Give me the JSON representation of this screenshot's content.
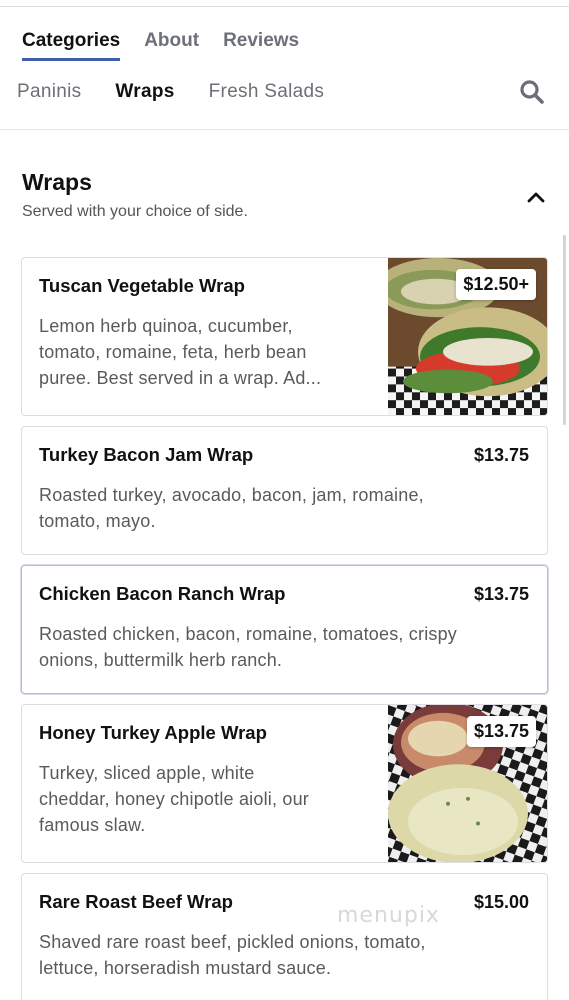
{
  "nav": {
    "top_tabs": [
      {
        "label": "Categories",
        "active": true
      },
      {
        "label": "About",
        "active": false
      },
      {
        "label": "Reviews",
        "active": false
      }
    ],
    "sub_tabs": [
      {
        "label": "Paninis",
        "active": false
      },
      {
        "label": "Wraps",
        "active": true
      },
      {
        "label": "Fresh Salads",
        "active": false
      }
    ],
    "search_icon": "search-icon"
  },
  "section": {
    "title": "Wraps",
    "subtitle": "Served with your choice of side.",
    "collapse_icon": "chevron-up-icon"
  },
  "items": [
    {
      "name": "Tuscan Vegetable Wrap",
      "price": "$12.50+",
      "desc_lines": [
        "Lemon herb quinoa, cucumber,",
        "tomato, romaine, feta, herb bean",
        "puree. Best served in a wrap. Ad..."
      ],
      "has_image": true
    },
    {
      "name": "Turkey Bacon Jam Wrap",
      "price": "$13.75",
      "desc_lines": [
        "Roasted turkey, avocado, bacon, jam, romaine,",
        "tomato, mayo."
      ],
      "has_image": false
    },
    {
      "name": "Chicken Bacon Ranch Wrap",
      "price": "$13.75",
      "desc_lines": [
        "Roasted chicken, bacon, romaine, tomatoes, crispy",
        "onions, buttermilk herb ranch."
      ],
      "has_image": false
    },
    {
      "name": "Honey Turkey Apple Wrap",
      "price": "$13.75",
      "desc_lines": [
        "Turkey, sliced apple, white",
        "cheddar, honey chipotle aioli, our",
        "famous slaw."
      ],
      "has_image": true
    },
    {
      "name": "Rare Roast Beef Wrap",
      "price": "$15.00",
      "desc_lines": [
        "Shaved rare roast beef, pickled onions, tomato,",
        "lettuce, horseradish mustard sauce."
      ],
      "has_image": false
    }
  ],
  "watermark": "menupix",
  "colors": {
    "active_underline": "#3d5fa8",
    "text_primary": "#111111",
    "text_muted": "#5a5a5e"
  }
}
